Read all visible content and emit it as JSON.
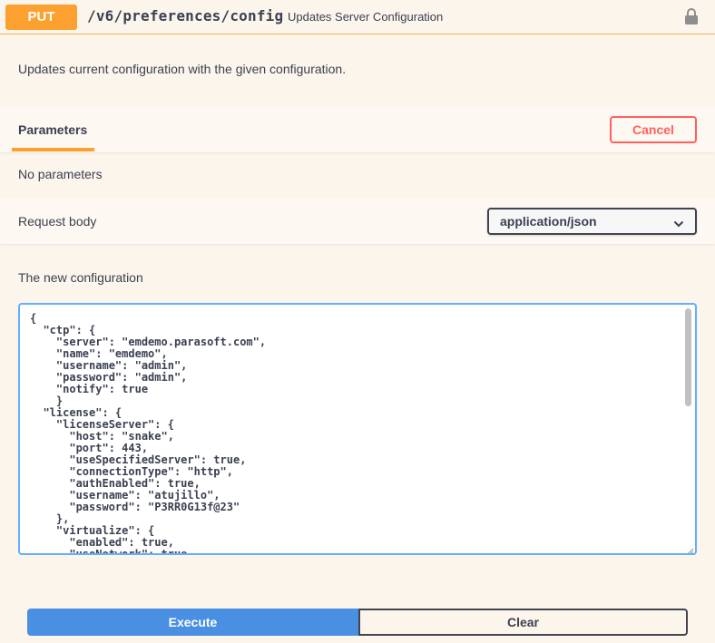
{
  "operation": {
    "method": "PUT",
    "path": "/v6/preferences/config",
    "summary": "Updates Server Configuration",
    "lock_icon": "lock-icon",
    "description": "Updates current configuration with the given configuration."
  },
  "parameters": {
    "tab_label": "Parameters",
    "cancel_label": "Cancel",
    "empty_text": "No parameters"
  },
  "request_body": {
    "label": "Request body",
    "content_type": "application/json",
    "chevron_icon": "chevron-down-icon",
    "field_label": "The new configuration",
    "value": "{\n  \"ctp\": {\n    \"server\": \"emdemo.parasoft.com\",\n    \"name\": \"emdemo\",\n    \"username\": \"admin\",\n    \"password\": \"admin\",\n    \"notify\": true\n    }\n  \"license\": {\n    \"licenseServer\": {\n      \"host\": \"snake\",\n      \"port\": 443,\n      \"useSpecifiedServer\": true,\n      \"connectionType\": \"http\",\n      \"authEnabled\": true,\n      \"username\": \"atujillo\",\n      \"password\": \"P3RR0G13f@23\"\n    },\n    \"virtualize\": {\n      \"enabled\": true,\n      \"useNetwork\": true"
  },
  "actions": {
    "execute_label": "Execute",
    "clear_label": "Clear"
  },
  "colors": {
    "method_put": "#fca130",
    "cancel": "#ff6060",
    "execute": "#4990e2",
    "editor_border": "#61affe"
  }
}
